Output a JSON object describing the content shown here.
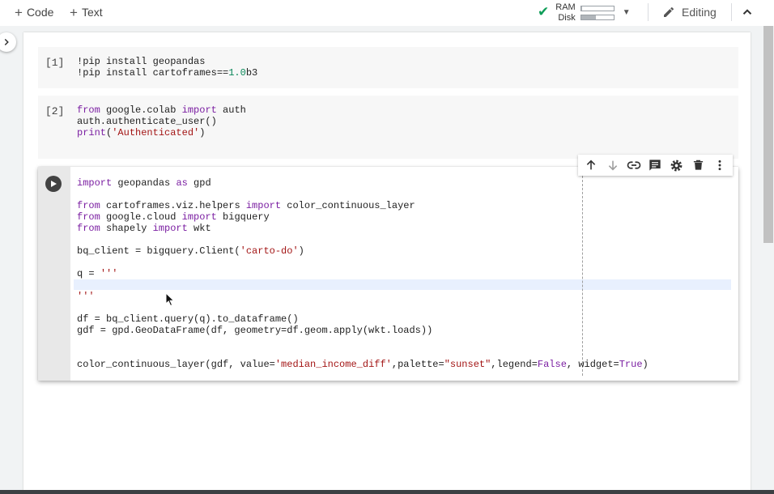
{
  "toolbar": {
    "code_label": "Code",
    "text_label": "Text",
    "ram_label": "RAM",
    "disk_label": "Disk",
    "ram_fill": 0.02,
    "disk_fill": 0.45,
    "editing_label": "Editing"
  },
  "cells": [
    {
      "prompt": "[1]",
      "lines": [
        [
          {
            "t": "!pip install geopandas",
            "c": ""
          }
        ],
        [
          {
            "t": "!pip install cartoframes==",
            "c": ""
          },
          {
            "t": "1.0",
            "c": "num"
          },
          {
            "t": "b3",
            "c": ""
          }
        ]
      ]
    },
    {
      "prompt": "[2]",
      "lines": [
        [
          {
            "t": "from",
            "c": "kw"
          },
          {
            "t": " google.colab ",
            "c": ""
          },
          {
            "t": "import",
            "c": "kw"
          },
          {
            "t": " auth",
            "c": ""
          }
        ],
        [
          {
            "t": "auth.authenticate_user()",
            "c": ""
          }
        ],
        [
          {
            "t": "print",
            "c": "kw"
          },
          {
            "t": "(",
            "c": ""
          },
          {
            "t": "'Authenticated'",
            "c": "str"
          },
          {
            "t": ")",
            "c": ""
          }
        ]
      ]
    },
    {
      "prompt": "",
      "lines": [
        [
          {
            "t": "import",
            "c": "kw"
          },
          {
            "t": " geopandas ",
            "c": ""
          },
          {
            "t": "as",
            "c": "kw"
          },
          {
            "t": " gpd",
            "c": ""
          }
        ],
        [],
        [
          {
            "t": "from",
            "c": "kw"
          },
          {
            "t": " cartoframes.viz.helpers ",
            "c": ""
          },
          {
            "t": "import",
            "c": "kw"
          },
          {
            "t": " color_continuous_layer",
            "c": ""
          }
        ],
        [
          {
            "t": "from",
            "c": "kw"
          },
          {
            "t": " google.cloud ",
            "c": ""
          },
          {
            "t": "import",
            "c": "kw"
          },
          {
            "t": " bigquery",
            "c": ""
          }
        ],
        [
          {
            "t": "from",
            "c": "kw"
          },
          {
            "t": " shapely ",
            "c": ""
          },
          {
            "t": "import",
            "c": "kw"
          },
          {
            "t": " wkt",
            "c": ""
          }
        ],
        [],
        [
          {
            "t": "bq_client = bigquery.Client(",
            "c": ""
          },
          {
            "t": "'carto-do'",
            "c": "str"
          },
          {
            "t": ")",
            "c": ""
          }
        ],
        [],
        [
          {
            "t": "q = ",
            "c": ""
          },
          {
            "t": "'''",
            "c": "str"
          }
        ],
        [],
        [
          {
            "t": "'''",
            "c": "str"
          }
        ],
        [],
        [
          {
            "t": "df = bq_client.query(q).to_dataframe()",
            "c": ""
          }
        ],
        [
          {
            "t": "gdf = gpd.GeoDataFrame(df, geometry=df.geom.apply(wkt.loads))",
            "c": ""
          }
        ],
        [],
        [],
        [
          {
            "t": "color_continuous_layer(gdf, value=",
            "c": ""
          },
          {
            "t": "'median_income_diff'",
            "c": "str"
          },
          {
            "t": ",palette=",
            "c": ""
          },
          {
            "t": "\"sunset\"",
            "c": "str"
          },
          {
            "t": ",legend=",
            "c": ""
          },
          {
            "t": "False",
            "c": "kw"
          },
          {
            "t": ", widget=",
            "c": ""
          },
          {
            "t": "True",
            "c": "kw"
          },
          {
            "t": ")",
            "c": ""
          }
        ]
      ]
    }
  ],
  "cell_toolbar_icons": [
    "arrow-up-icon",
    "arrow-down-icon",
    "link-icon",
    "comment-icon",
    "gear-icon",
    "trash-icon",
    "more-vert-icon"
  ],
  "colors": {
    "keyword": "#7b1fa2",
    "string": "#a31515",
    "number": "#098658",
    "check": "#0f9d58"
  }
}
